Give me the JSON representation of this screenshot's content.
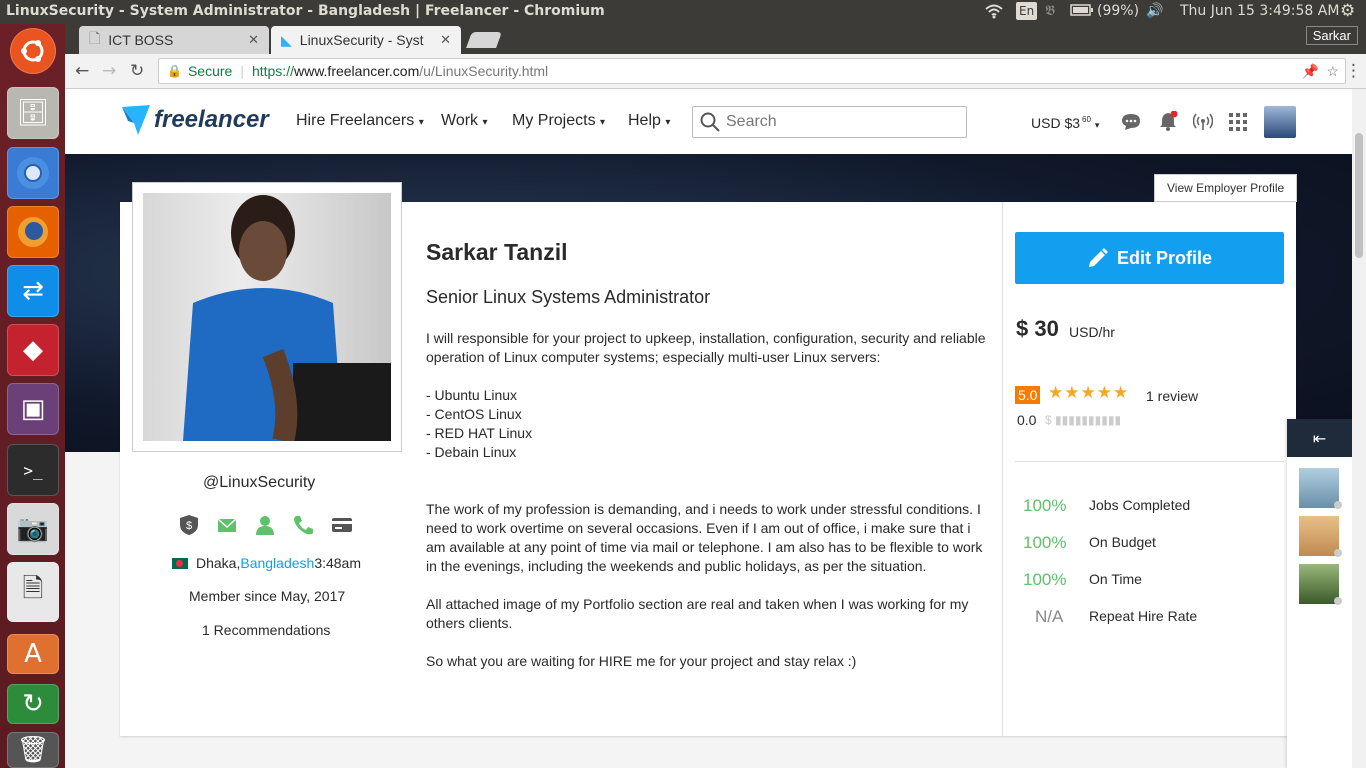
{
  "os": {
    "window_title": "LinuxSecurity - System Administrator - Bangladesh | Freelancer - Chromium",
    "keyboard": "En",
    "battery": "(99%)",
    "clock": "Thu Jun 15  3:49:58 AM"
  },
  "browser": {
    "tabs": [
      {
        "label": "ICT BOSS"
      },
      {
        "label": "LinuxSecurity - Syst"
      }
    ],
    "profile": "Sarkar",
    "secure_label": "Secure",
    "url_scheme": "https://",
    "url_host": "www.freelancer.com",
    "url_path": "/u/LinuxSecurity.html"
  },
  "site": {
    "logo": "freelancer",
    "nav": [
      "Hire Freelancers",
      "Work",
      "My Projects",
      "Help"
    ],
    "search_placeholder": "Search",
    "balance": "USD $3",
    "balance_cents": "60"
  },
  "profile": {
    "view_employer": "View Employer Profile",
    "name": "Sarkar Tanzil",
    "headline": "Senior Linux Systems Administrator",
    "summary_1": "I will responsible for your project to upkeep, installation, configuration, security and reliable operation of Linux computer systems; especially multi-user Linux servers:",
    "skills": [
      "- Ubuntu Linux",
      "- CentOS Linux",
      "- RED HAT Linux",
      "- Debain Linux"
    ],
    "summary_2": "The work of my profession is demanding, and i needs to work under stressful conditions. I need to work overtime on several occasions. Even if I am out of office, i make sure that i am available at any point of time via mail or telephone. I am also has to be flexible to work in the evenings, including the weekends and public holidays, as per the situation.",
    "summary_3": "All attached image of my Portfolio section are real and taken when I was working for my others clients.",
    "summary_4": "So what you are waiting for HIRE me for your project and stay relax :)",
    "username": "@LinuxSecurity",
    "city": "Dhaka, ",
    "country": "Bangladesh",
    "local_time": " 3:48am",
    "member_since": "Member since May, 2017",
    "recommendations": "1 Recommendations",
    "edit_button": "Edit Profile",
    "rate_amount": "$ 30",
    "rate_unit": "USD/hr",
    "rating": "5.0",
    "rating_stars": 5,
    "reviews": "1 review",
    "earnings_score": "0.0",
    "stats": [
      {
        "value": "100%",
        "label": "Jobs Completed"
      },
      {
        "value": "100%",
        "label": "On Budget"
      },
      {
        "value": "100%",
        "label": "On Time"
      },
      {
        "value": "N/A",
        "label": "Repeat Hire Rate"
      }
    ]
  },
  "colors": {
    "brand": "#29b2fe",
    "edit_button": "#139ff0",
    "stat_green": "#5dc26a",
    "rating_badge": "#f77b00",
    "star": "#f7a823",
    "link": "#139ff0"
  }
}
